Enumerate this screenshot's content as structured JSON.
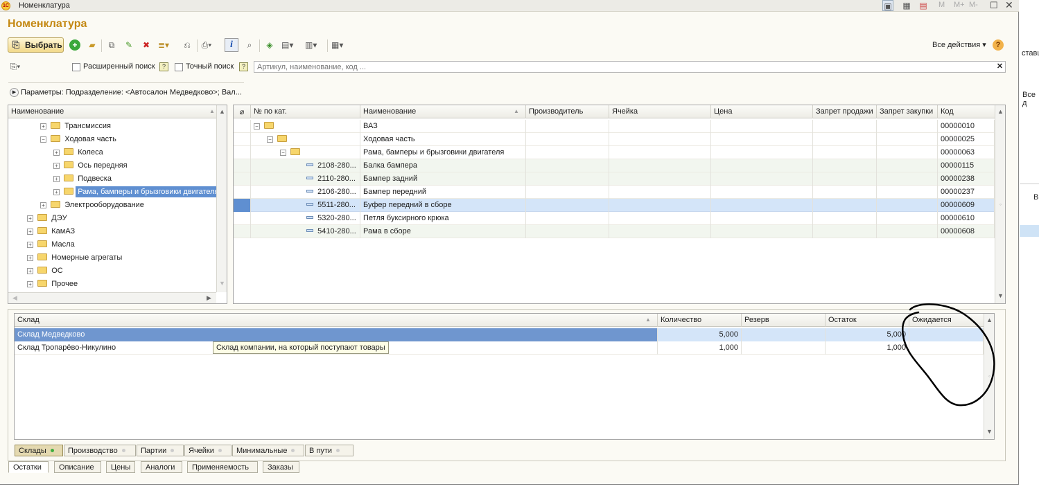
{
  "window": {
    "title": "Номенклатура",
    "controls": [
      "M",
      "M+",
      "M-"
    ]
  },
  "form": {
    "title": "Номенклатура"
  },
  "toolbar": {
    "select_label": "Выбрать",
    "all_actions": "Все действия",
    "help": "?"
  },
  "search": {
    "extended_label": "Расширенный поиск",
    "exact_label": "Точный поиск",
    "hint": "?",
    "placeholder": "Артикул, наименование, код ...",
    "clear": "✕"
  },
  "params": {
    "text": "Параметры: Подразделение: <Автосалон Медведково>; Вал..."
  },
  "tree": {
    "header": "Наименование",
    "items": [
      {
        "label": "Трансмиссия",
        "state": "+"
      },
      {
        "label": "Ходовая часть",
        "state": "−"
      },
      {
        "label": "Колеса",
        "state": "+"
      },
      {
        "label": "Ось передняя",
        "state": "+"
      },
      {
        "label": "Подвеска",
        "state": "+"
      },
      {
        "label": "Рама, бамперы и брызговики двигателя",
        "state": "+"
      },
      {
        "label": "Электрооборудование",
        "state": "+"
      },
      {
        "label": "ДЭУ",
        "state": "+"
      },
      {
        "label": "КамАЗ",
        "state": "+"
      },
      {
        "label": "Масла",
        "state": "+"
      },
      {
        "label": "Номерные агрегаты",
        "state": "+"
      },
      {
        "label": "ОС",
        "state": "+"
      },
      {
        "label": "Прочее",
        "state": "+"
      }
    ]
  },
  "grid": {
    "headers": [
      "№ по кат.",
      "Наименование",
      "Производитель",
      "Ячейка",
      "Цена",
      "Запрет продажи",
      "Запрет закупки",
      "Код"
    ],
    "rows": [
      {
        "cat": "",
        "name": "ВАЗ",
        "code": "00000010"
      },
      {
        "cat": "",
        "name": "Ходовая часть",
        "code": "00000025"
      },
      {
        "cat": "",
        "name": "Рама, бамперы и брызговики двигателя",
        "code": "00000063"
      },
      {
        "cat": "2108-280...",
        "name": "Балка бампера",
        "code": "00000115"
      },
      {
        "cat": "2110-280...",
        "name": "Бампер задний",
        "code": "00000238"
      },
      {
        "cat": "2106-280...",
        "name": "Бампер передний",
        "code": "00000237"
      },
      {
        "cat": "5511-280...",
        "name": "Буфер передний в сборе",
        "code": "00000609"
      },
      {
        "cat": "5320-280...",
        "name": "Петля буксирного крюка",
        "code": "00000610"
      },
      {
        "cat": "5410-280...",
        "name": "Рама в сборе",
        "code": "00000608"
      }
    ]
  },
  "stock": {
    "headers": [
      "Склад",
      "Количество",
      "Резерв",
      "Остаток",
      "Ожидается"
    ],
    "rows": [
      {
        "wh": "Склад Медведково",
        "qty": "5,000",
        "res": "",
        "rest": "5,000",
        "exp": ""
      },
      {
        "wh": "Склад Тропарёво-Никулино",
        "qty": "1,000",
        "res": "",
        "rest": "1,000",
        "exp": ""
      }
    ],
    "tooltip": "Склад компании, на который поступают товары"
  },
  "inner_tabs": [
    "Склады",
    "Производство",
    "Партии",
    "Ячейки",
    "Минимальные",
    "В пути"
  ],
  "bottom_tabs": [
    "Остатки",
    "Описание",
    "Цены",
    "Аналоги",
    "Применяемость",
    "Заказы"
  ],
  "background": {
    "text1": "ставщ",
    "text2": "Все д",
    "text3": "В"
  }
}
